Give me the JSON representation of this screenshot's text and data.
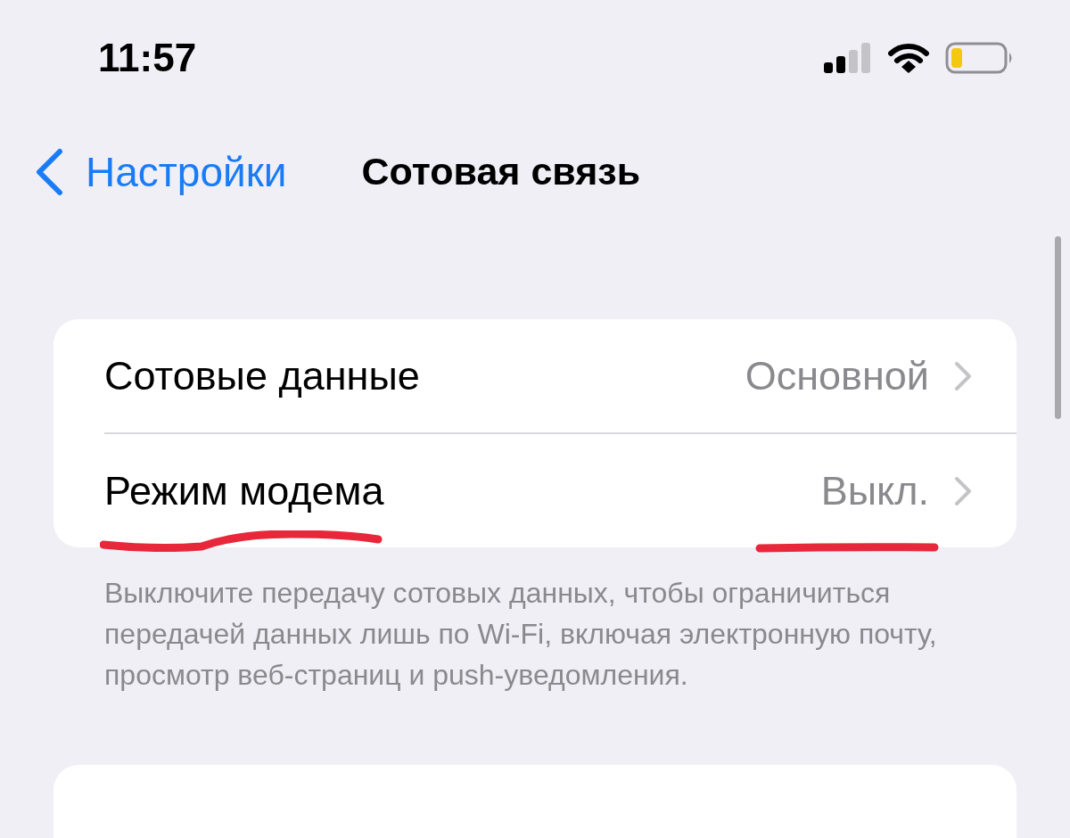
{
  "status_bar": {
    "time": "11:57"
  },
  "nav": {
    "back_label": "Настройки",
    "title": "Сотовая связь"
  },
  "rows": [
    {
      "label": "Сотовые данные",
      "value": "Основной",
      "underlined": false
    },
    {
      "label": "Режим модема",
      "value": "Выкл.",
      "underlined": true
    }
  ],
  "footer": "Выключите передачу сотовых данных, чтобы ограничиться передачей данных лишь по Wi-Fi, включая электронную почту, просмотр веб-страниц и push-уведомления."
}
